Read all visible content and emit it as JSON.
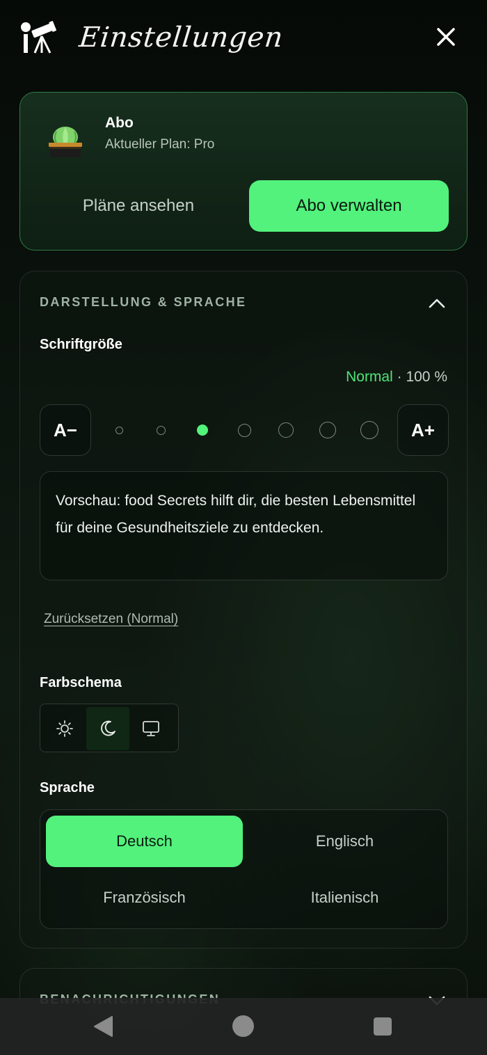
{
  "header": {
    "title": "Einstellungen",
    "logo_icon": "telescope-icon",
    "close_icon": "close-icon"
  },
  "subscription": {
    "title": "Abo",
    "plan": "Aktueller Plan: Pro",
    "icon": "lettuce-crate-icon",
    "view_plans_label": "Pläne ansehen",
    "manage_label": "Abo verwalten"
  },
  "appearance": {
    "title": "DARSTELLUNG & SPRACHE",
    "expanded": true,
    "font_size": {
      "label": "Schriftgröße",
      "value_name": "Normal",
      "value_percent": "· 100 %",
      "decrease_label": "A−",
      "increase_label": "A+",
      "steps": 7,
      "selected_step": 3
    },
    "preview_text": "Vorschau: food Secrets hilft dir, die besten Lebensmittel für deine Gesundheitsziele zu entdecken.",
    "reset_label": "Zurücksetzen (Normal)",
    "color_scheme": {
      "label": "Farbschema",
      "options": [
        "sun-icon",
        "moon-icon",
        "monitor-icon"
      ],
      "selected": "moon-icon"
    },
    "language": {
      "label": "Sprache",
      "options": [
        "Deutsch",
        "Englisch",
        "Französisch",
        "Italienisch"
      ],
      "selected": "Deutsch"
    }
  },
  "notifications": {
    "title": "BENACHRICHTIGUNGEN",
    "expanded": false
  },
  "navbar": {
    "back_icon": "back-triangle-icon",
    "home_icon": "home-circle-icon",
    "recents_icon": "recents-square-icon"
  },
  "colors": {
    "accent": "#52f27c",
    "accent_text": "#52e37a",
    "card_border": "#2f7a45",
    "background": "#0b130d"
  }
}
